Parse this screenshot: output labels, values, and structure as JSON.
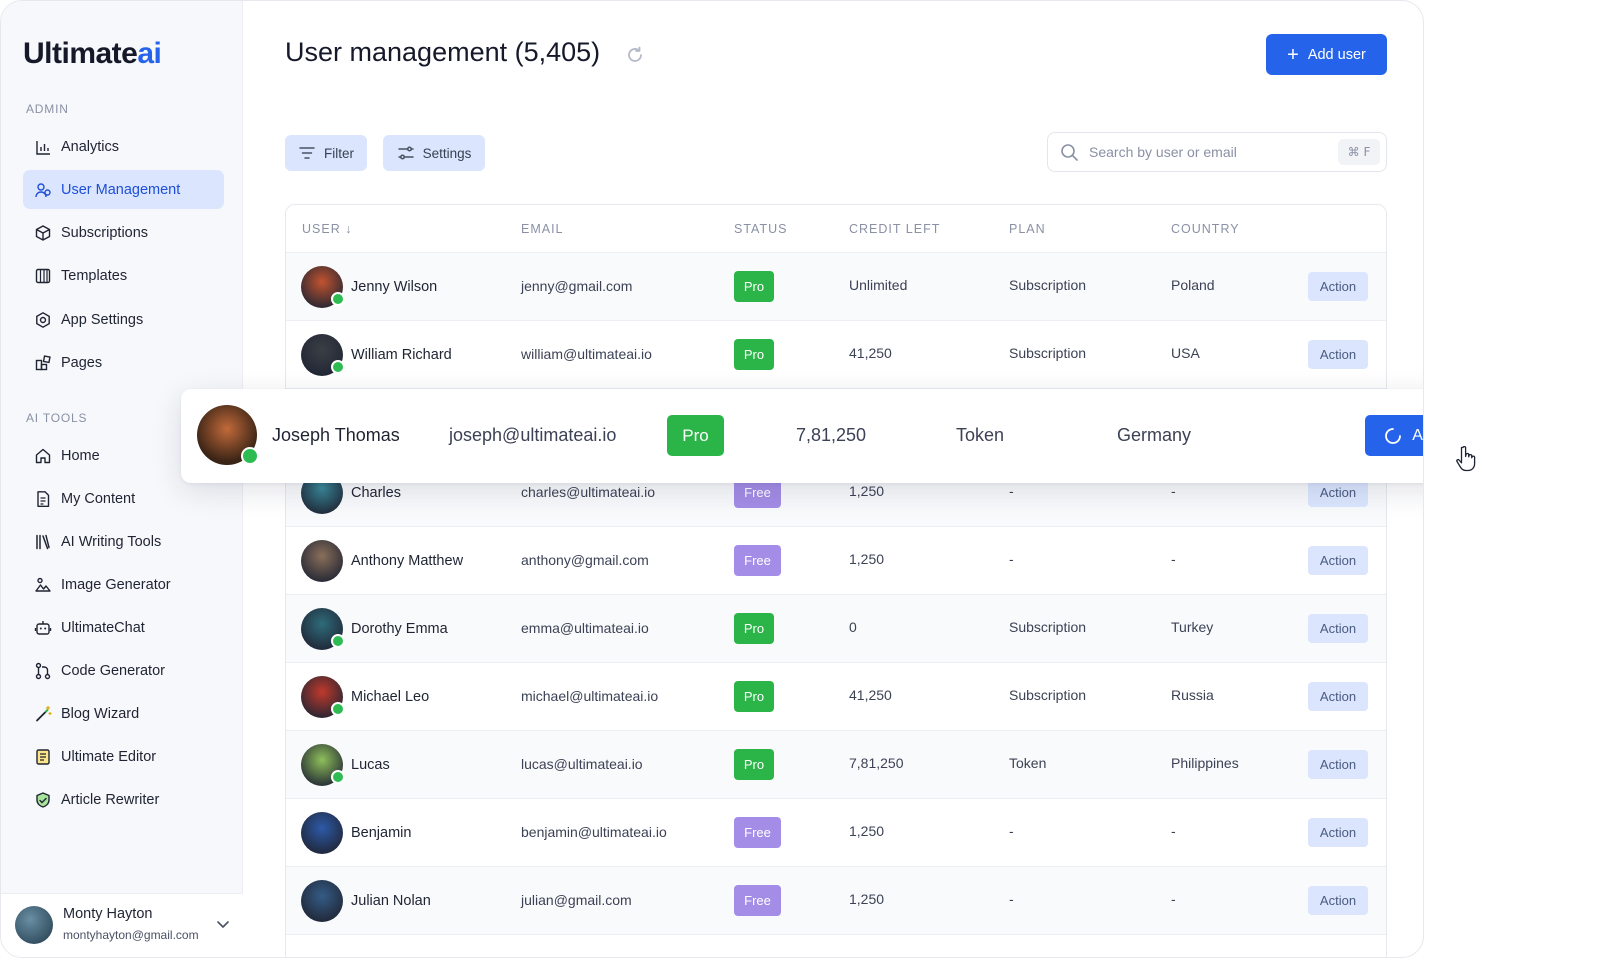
{
  "brand": {
    "name_main": "Ultimate",
    "name_accent": "ai"
  },
  "sidebar": {
    "admin_label": "ADMIN",
    "ai_tools_label": "AI TOOLS",
    "admin_items": [
      {
        "label": "Analytics",
        "icon": "bar-chart-icon"
      },
      {
        "label": "User Management",
        "icon": "users-icon",
        "active": true
      },
      {
        "label": "Subscriptions",
        "icon": "box-icon"
      },
      {
        "label": "Templates",
        "icon": "columns-icon"
      },
      {
        "label": "App Settings",
        "icon": "settings-icon"
      },
      {
        "label": "Pages",
        "icon": "pages-icon"
      }
    ],
    "ai_items": [
      {
        "label": "Home",
        "icon": "home-icon"
      },
      {
        "label": "My Content",
        "icon": "document-icon"
      },
      {
        "label": "AI Writing Tools",
        "icon": "books-icon"
      },
      {
        "label": "Image Generator",
        "icon": "image-icon"
      },
      {
        "label": "UltimateChat",
        "icon": "robot-icon"
      },
      {
        "label": "Code Generator",
        "icon": "git-branch-icon"
      },
      {
        "label": "Blog Wizard",
        "icon": "magic-wand-icon"
      },
      {
        "label": "Ultimate Editor",
        "icon": "editor-icon"
      },
      {
        "label": "Article Rewriter",
        "icon": "rewriter-icon"
      }
    ],
    "profile": {
      "name": "Monty Hayton",
      "email": "montyhayton@gmail.com"
    }
  },
  "header": {
    "title": "User management (5,405)",
    "add_user_label": "Add user"
  },
  "toolbar": {
    "filter_label": "Filter",
    "settings_label": "Settings",
    "search_placeholder": "Search by user or email",
    "search_shortcut": "⌘ F"
  },
  "table": {
    "columns": [
      "USER ↓",
      "EMAIL",
      "STATUS",
      "CREDIT LEFT",
      "PLAN",
      "COUNTRY"
    ],
    "action_label": "Action",
    "rows": [
      {
        "name": "Jenny Wilson",
        "email": "jenny@gmail.com",
        "status": "Pro",
        "credit": "Unlimited",
        "plan": "Subscription",
        "country": "Poland",
        "verified": true,
        "avatar": "#c2532f"
      },
      {
        "name": "William Richard",
        "email": "william@ultimateai.io",
        "status": "Pro",
        "credit": "41,250",
        "plan": "Subscription",
        "country": "USA",
        "verified": true,
        "avatar": "#3a3f45"
      },
      {
        "name": "Charles",
        "email": "charles@ultimateai.io",
        "status": "Free",
        "credit": "1,250",
        "plan": "-",
        "country": "-",
        "verified": false,
        "avatar": "#3a8a9a"
      },
      {
        "name": "Anthony Matthew",
        "email": "anthony@gmail.com",
        "status": "Free",
        "credit": "1,250",
        "plan": "-",
        "country": "-",
        "verified": false,
        "avatar": "#8a6f5a"
      },
      {
        "name": "Dorothy Emma",
        "email": "emma@ultimateai.io",
        "status": "Pro",
        "credit": "0",
        "plan": "Subscription",
        "country": "Turkey",
        "verified": true,
        "avatar": "#2e6b7a"
      },
      {
        "name": "Michael Leo",
        "email": "michael@ultimateai.io",
        "status": "Pro",
        "credit": "41,250",
        "plan": "Subscription",
        "country": "Russia",
        "verified": true,
        "avatar": "#c0392b"
      },
      {
        "name": "Lucas",
        "email": "lucas@ultimateai.io",
        "status": "Pro",
        "credit": "7,81,250",
        "plan": "Token",
        "country": "Philippines",
        "verified": true,
        "avatar": "#8fbf5a"
      },
      {
        "name": "Benjamin",
        "email": "benjamin@ultimateai.io",
        "status": "Free",
        "credit": "1,250",
        "plan": "-",
        "country": "-",
        "verified": false,
        "avatar": "#2d5aa8"
      },
      {
        "name": "Julian Nolan",
        "email": "julian@gmail.com",
        "status": "Free",
        "credit": "1,250",
        "plan": "-",
        "country": "-",
        "verified": false,
        "avatar": "#355c86"
      }
    ]
  },
  "highlight_row": {
    "name": "Joseph Thomas",
    "email": "joseph@ultimateai.io",
    "status": "Pro",
    "credit": "7,81,250",
    "plan": "Token",
    "country": "Germany",
    "action_label": "Action"
  },
  "colors": {
    "accent": "#2563eb",
    "pro": "#2bb447",
    "free": "#a48de6",
    "action_bg": "#dbe6fe"
  }
}
